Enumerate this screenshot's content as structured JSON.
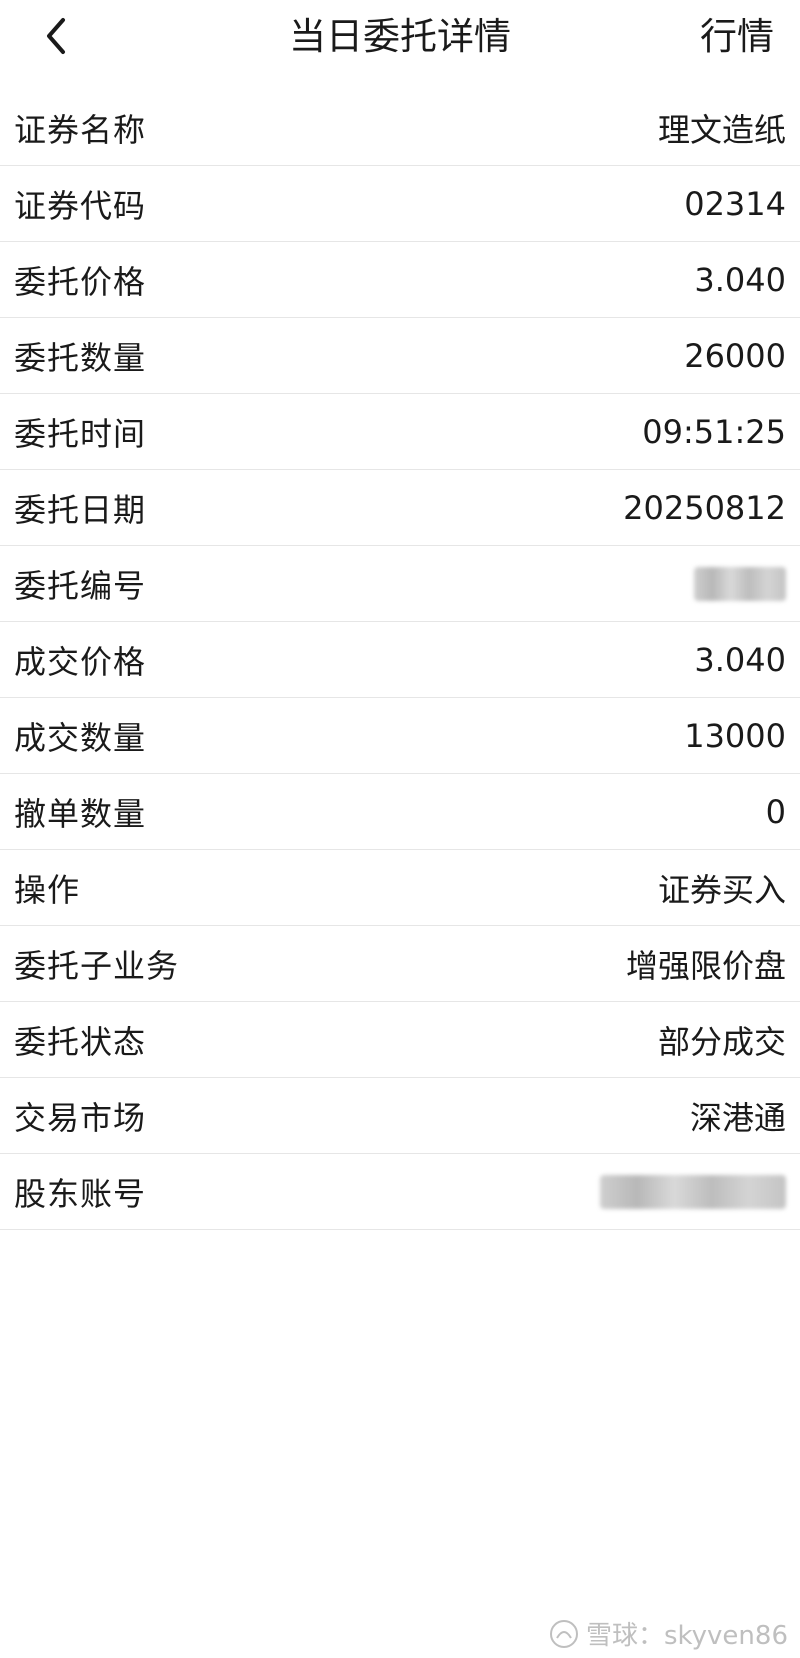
{
  "header": {
    "title": "当日委托详情",
    "market_label": "行情",
    "back_icon": "chevron-left-icon"
  },
  "rows": [
    {
      "label": "证券名称",
      "value": "理文造纸"
    },
    {
      "label": "证券代码",
      "value": "02314"
    },
    {
      "label": "委托价格",
      "value": "3.040"
    },
    {
      "label": "委托数量",
      "value": "26000"
    },
    {
      "label": "委托时间",
      "value": "09:51:25"
    },
    {
      "label": "委托日期",
      "value": "20250812"
    },
    {
      "label": "委托编号",
      "value": ""
    },
    {
      "label": "成交价格",
      "value": "3.040"
    },
    {
      "label": "成交数量",
      "value": "13000"
    },
    {
      "label": "撤单数量",
      "value": "0"
    },
    {
      "label": "操作",
      "value": "证券买入"
    },
    {
      "label": "委托子业务",
      "value": "增强限价盘"
    },
    {
      "label": "委托状态",
      "value": "部分成交"
    },
    {
      "label": "交易市场",
      "value": "深港通"
    },
    {
      "label": "股东账号",
      "value": ""
    }
  ],
  "watermark": {
    "text": "雪球：skyven86",
    "icon": "snowball-logo-icon"
  }
}
